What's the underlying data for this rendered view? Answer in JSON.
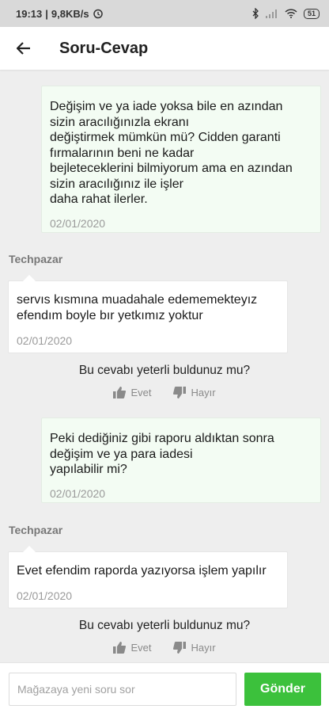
{
  "status_bar": {
    "time": "19:13",
    "network_speed": "9,8KB/s",
    "battery": "51"
  },
  "header": {
    "title": "Soru-Cevap"
  },
  "conversation": [
    {
      "question": "Değişim ve ya iade yoksa bile en azından\nsizin aracılığınızla ekranı\ndeğiştirmek mümkün mü? Cidden garanti\nfırmalarının beni ne kadar\nbejleteceklerini bilmiyorum ama en azından\nsizin aracılığınız ile işler\ndaha rahat ilerler.",
      "question_date": "02/01/2020",
      "seller": "Techpazar",
      "answer": "servıs kısmına muadahale edememekteyız\nefendım boyle bır yetkımız yoktur",
      "answer_date": "02/01/2020",
      "feedback_question": "Bu cevabı yeterli buldunuz mu?",
      "yes_label": "Evet",
      "no_label": "Hayır"
    },
    {
      "question": "Peki dediğiniz gibi raporu aldıktan sonra\ndeğişim ve ya para iadesi\nyapılabilir mi?",
      "question_date": "02/01/2020",
      "seller": "Techpazar",
      "answer": "Evet efendim raporda yazıyorsa işlem yapılır",
      "answer_date": "02/01/2020",
      "feedback_question": "Bu cevabı yeterli buldunuz mu?",
      "yes_label": "Evet",
      "no_label": "Hayır"
    }
  ],
  "composer": {
    "placeholder": "Mağazaya yeni soru sor",
    "value": "",
    "send_label": "Gönder"
  },
  "colors": {
    "accent": "#3cc13c",
    "question_bg": "#f3fcf3",
    "answer_bg": "#ffffff"
  },
  "icons": [
    "back-arrow-icon",
    "alarm-icon",
    "bluetooth-icon",
    "signal-icon",
    "wifi-icon",
    "battery-icon",
    "thumbs-up-icon",
    "thumbs-down-icon"
  ]
}
